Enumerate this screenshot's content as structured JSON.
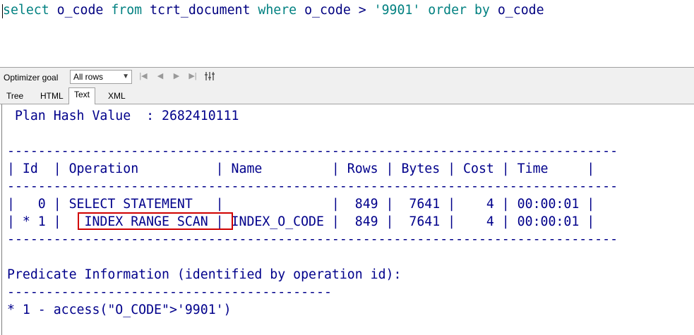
{
  "editor": {
    "sql_parts": [
      "select",
      " o_code ",
      "from",
      " tcrt_document ",
      "where",
      " o_code > ",
      "'9901'",
      " ",
      "order by",
      " o_code"
    ]
  },
  "toolbar": {
    "optimizer_label": "Optimizer goal",
    "optimizer_value": "All rows",
    "nav_buttons": [
      "first-icon",
      "prev-icon",
      "next-icon",
      "last-icon",
      "columns-icon"
    ]
  },
  "tabs": [
    "Tree",
    "HTML",
    "Text",
    "XML"
  ],
  "active_tab": "Text",
  "plan_text": " Plan Hash Value  : 2682410111\n\n-------------------------------------------------------------------------------\n| Id  | Operation          | Name         | Rows | Bytes | Cost | Time     |\n-------------------------------------------------------------------------------\n|   0 | SELECT STATEMENT   |              |  849 |  7641 |    4 | 00:00:01 |\n| * 1 |   INDEX RANGE SCAN | INDEX_O_CODE |  849 |  7641 |    4 | 00:00:01 |\n-------------------------------------------------------------------------------\n\nPredicate Information (identified by operation id):\n------------------------------------------\n* 1 - access(\"O_CODE\">'9901')",
  "highlight": "INDEX RANGE SCAN"
}
